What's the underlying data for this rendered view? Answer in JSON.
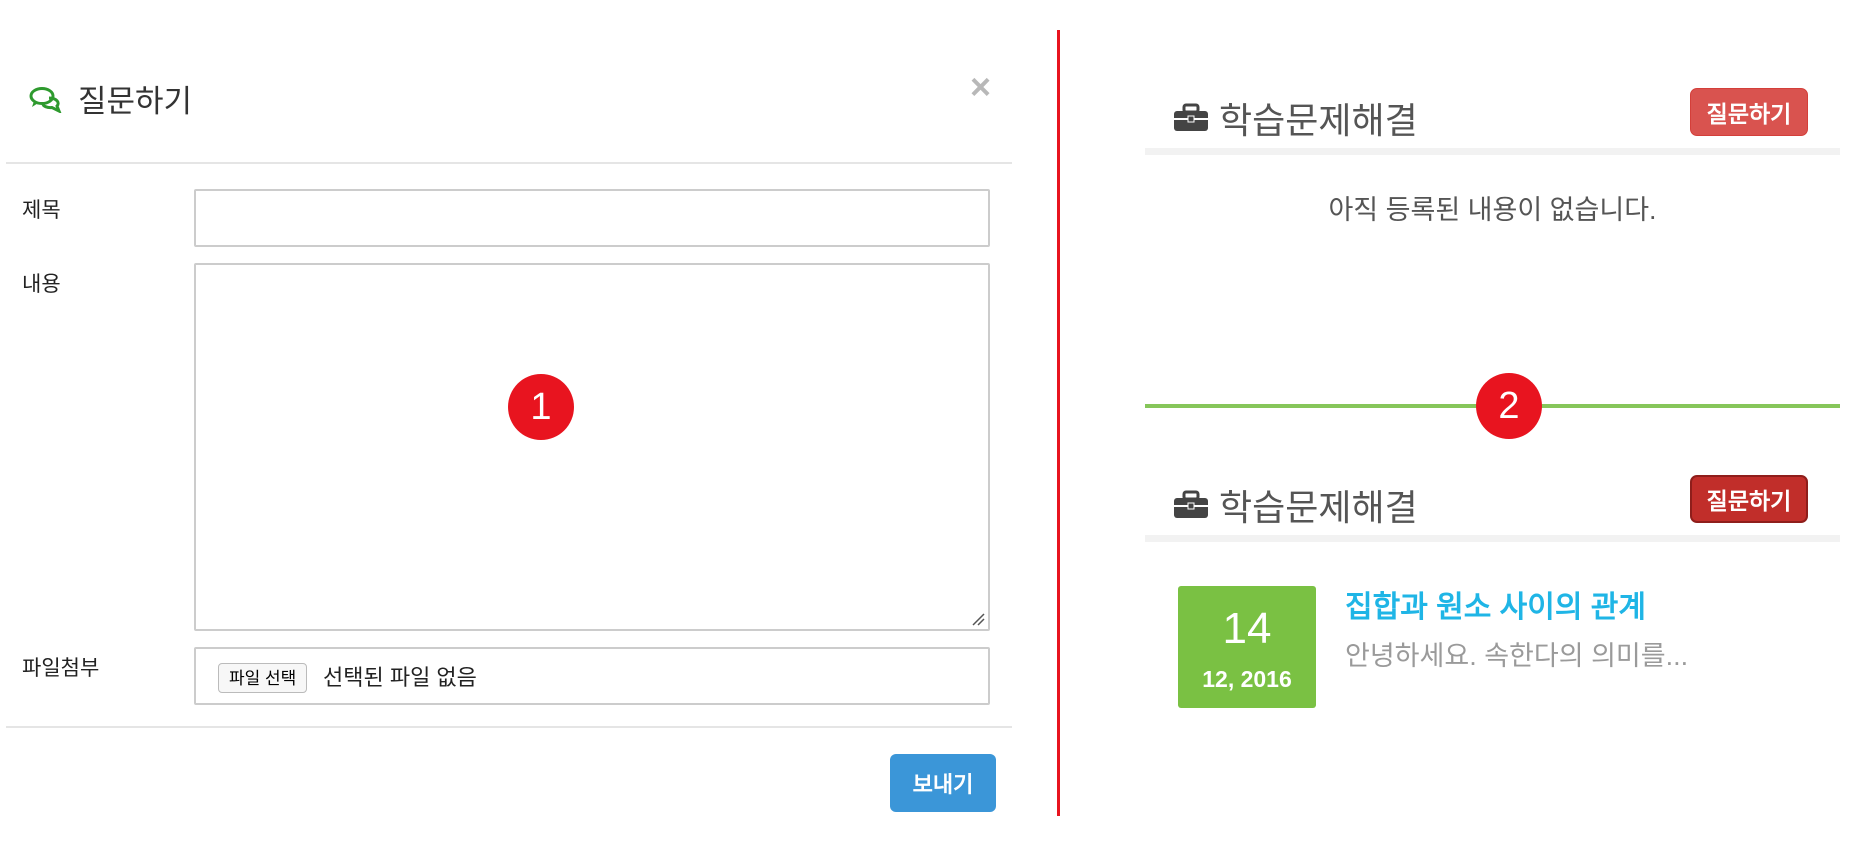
{
  "modal": {
    "title": "질문하기",
    "icon": "chat-bubbles-icon",
    "close_label": "×",
    "fields": {
      "subject_label": "제목",
      "subject_value": "",
      "content_label": "내용",
      "content_value": "",
      "attachment_label": "파일첨부",
      "file_button": "파일 선택",
      "file_status": "선택된 파일 없음"
    },
    "submit_label": "보내기"
  },
  "badges": {
    "one": "1",
    "two": "2"
  },
  "panels": {
    "empty": {
      "title": "학습문제해결",
      "ask_button": "질문하기",
      "message": "아직 등록된 내용이 없습니다."
    },
    "filled": {
      "title": "학습문제해결",
      "ask_button": "질문하기",
      "post": {
        "day": "14",
        "month_year": "12, 2016",
        "title": "집합과 원소 사이의 관계",
        "excerpt": "안녕하세요. 속한다의 의미를..."
      }
    }
  },
  "colors": {
    "accent_red": "#e8141f",
    "ask_button_normal": "#d9534f",
    "ask_button_active": "#c12e2a",
    "send_button": "#3b96d8",
    "date_green": "#7ac143",
    "link_blue": "#1fb5e6",
    "divider_green": "#86c65a"
  }
}
